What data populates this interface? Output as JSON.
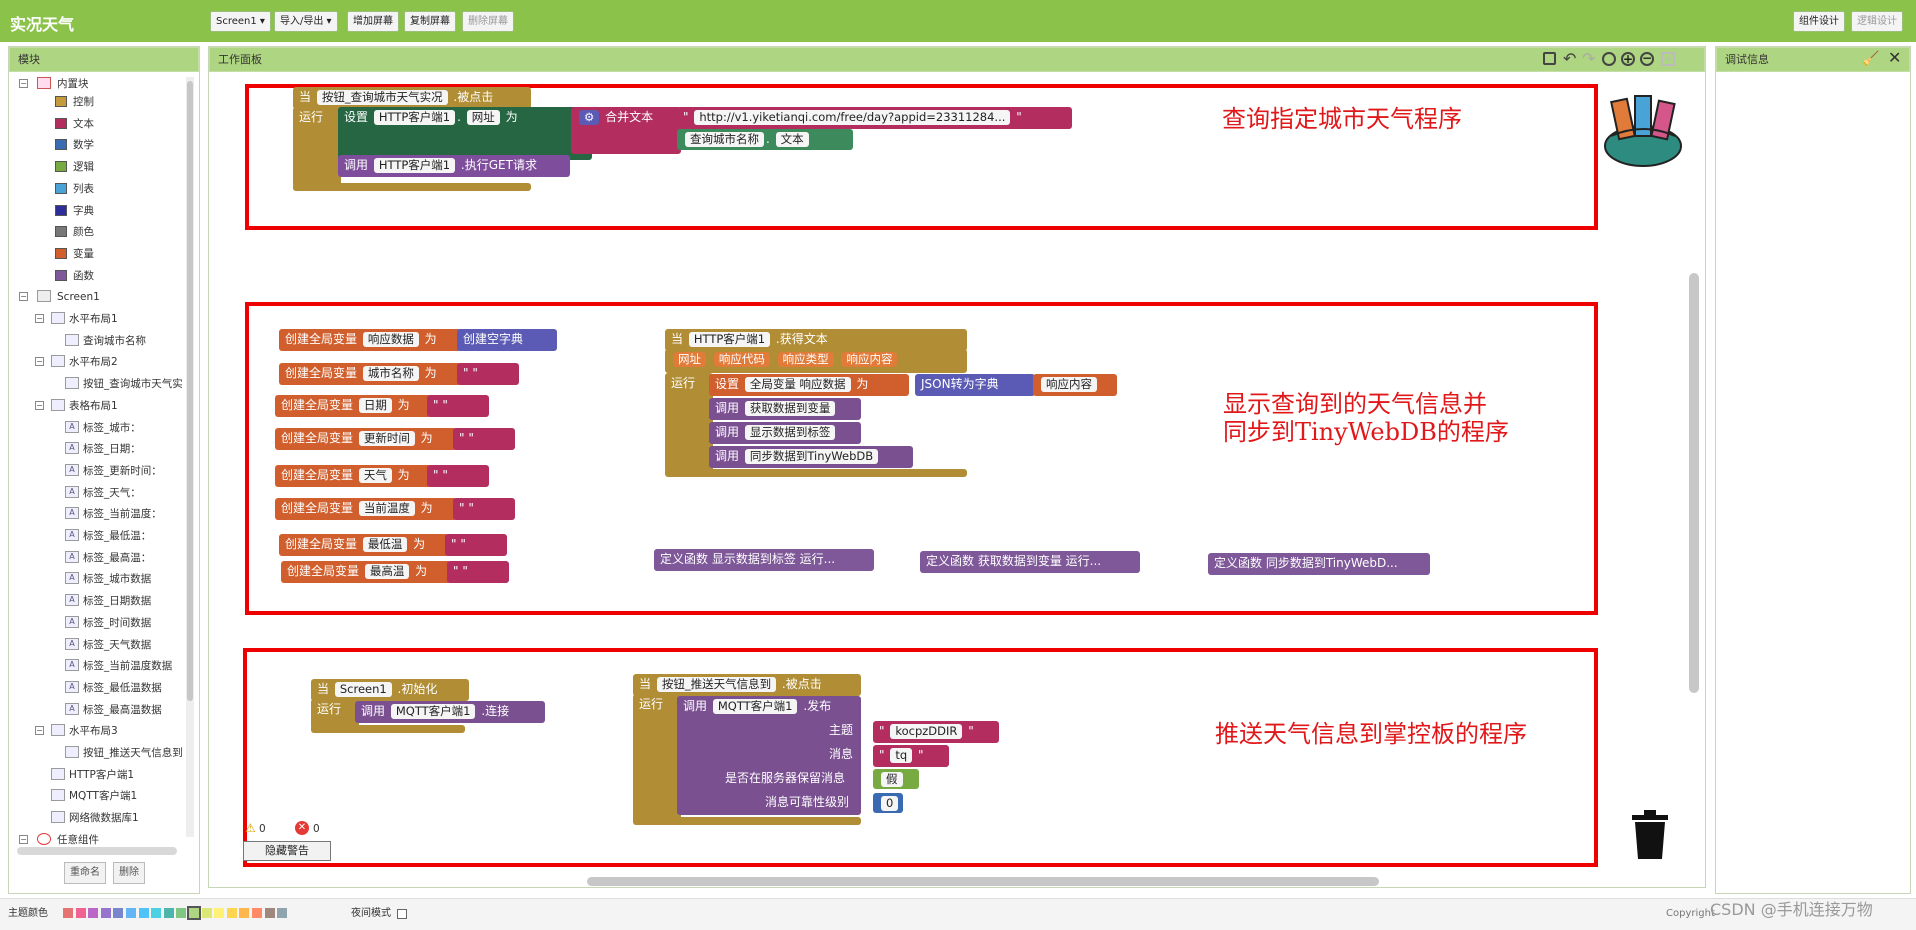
{
  "app": {
    "title": "实况天气"
  },
  "toolbar": {
    "screen_select": "Screen1 ▾",
    "import_export": "导入/导出 ▾",
    "add_screen": "增加屏幕",
    "copy_screen": "复制屏幕",
    "delete_screen": "删除屏幕",
    "designer": "组件设计",
    "blocks": "逻辑设计"
  },
  "left_panel": {
    "title": "模块",
    "builtins_label": "内置块",
    "builtins": [
      {
        "label": "控制",
        "color": "#c49b3a"
      },
      {
        "label": "文本",
        "color": "#b32d5e"
      },
      {
        "label": "数学",
        "color": "#3a6ab1"
      },
      {
        "label": "逻辑",
        "color": "#77ab41"
      },
      {
        "label": "列表",
        "color": "#4aa3d6"
      },
      {
        "label": "字典",
        "color": "#2d2d9c"
      },
      {
        "label": "颜色",
        "color": "#777777"
      },
      {
        "label": "变量",
        "color": "#d05f2d"
      },
      {
        "label": "函数",
        "color": "#7e5898"
      }
    ],
    "screen_label": "Screen1",
    "components": [
      {
        "label": "水平布局1",
        "level": 1
      },
      {
        "label": "查询城市名称",
        "level": 2
      },
      {
        "label": "水平布局2",
        "level": 1
      },
      {
        "label": "按钮_查询城市天气实",
        "level": 2
      },
      {
        "label": "表格布局1",
        "level": 1
      },
      {
        "label": "标签_城市：",
        "level": 2
      },
      {
        "label": "标签_日期：",
        "level": 2
      },
      {
        "label": "标签_更新时间：",
        "level": 2
      },
      {
        "label": "标签_天气：",
        "level": 2
      },
      {
        "label": "标签_当前温度：",
        "level": 2
      },
      {
        "label": "标签_最低温：",
        "level": 2
      },
      {
        "label": "标签_最高温：",
        "level": 2
      },
      {
        "label": "标签_城市数据",
        "level": 2
      },
      {
        "label": "标签_日期数据",
        "level": 2
      },
      {
        "label": "标签_时间数据",
        "level": 2
      },
      {
        "label": "标签_天气数据",
        "level": 2
      },
      {
        "label": "标签_当前温度数据",
        "level": 2
      },
      {
        "label": "标签_最低温数据",
        "level": 2
      },
      {
        "label": "标签_最高温数据",
        "level": 2
      },
      {
        "label": "水平布局3",
        "level": 1
      },
      {
        "label": "按钮_推送天气信息到",
        "level": 2
      },
      {
        "label": "HTTP客户端1",
        "level": 1
      },
      {
        "label": "MQTT客户端1",
        "level": 1
      },
      {
        "label": "网络微数据库1",
        "level": 1
      }
    ],
    "any_component": "任意组件",
    "rename_btn": "重命名",
    "delete_btn": "删除"
  },
  "workspace": {
    "title": "工作面板",
    "section1": {
      "note": "查询指定城市天气程序",
      "when": "当",
      "button": "按钮_查询城市天气实况",
      "event": ".被点击",
      "do": "运行",
      "set": "设置",
      "http": "HTTP客户端1",
      "dot": ".",
      "prop_url": "网址",
      "to": "为",
      "join": "合并文本",
      "quote": "\"",
      "url_text": "http://v1.yiketianqi.com/free/day?appid=23311284...",
      "city_comp": "查询城市名称",
      "prop_text": "文本",
      "call": "调用",
      "get_method": ".执行GET请求"
    },
    "section2": {
      "note1": "显示查询到的天气信息并",
      "note2": "同步到TinyWebDB的程序",
      "globals_prefix": "创建全局变量",
      "to": "为",
      "globals": [
        {
          "name": "响应数据",
          "init": "创建空字典"
        },
        {
          "name": "城市名称",
          "init": "\" \""
        },
        {
          "name": "日期",
          "init": "\" \""
        },
        {
          "name": "更新时间",
          "init": "\" \""
        },
        {
          "name": "天气",
          "init": "\" \""
        },
        {
          "name": "当前温度",
          "init": "\" \""
        },
        {
          "name": "最低温",
          "init": "\" \""
        },
        {
          "name": "最高温",
          "init": "\" \""
        }
      ],
      "when": "当",
      "http": "HTTP客户端1",
      "got_text": ".获得文本",
      "params": [
        "网址",
        "响应代码",
        "响应类型",
        "响应内容"
      ],
      "do": "运行",
      "set": "设置",
      "global_var": "全局变量 响应数据",
      "json_to_dict": "JSON转为字典",
      "resp_content": "响应内容",
      "call": "调用",
      "calls": [
        "获取数据到变量",
        "显示数据到标签",
        "同步数据到TinyWebDB"
      ],
      "procs": [
        "定义函数 显示数据到标签 运行...",
        "定义函数 获取数据到变量 运行...",
        "定义函数 同步数据到TinyWebD..."
      ]
    },
    "section3": {
      "note": "推送天气信息到掌控板的程序",
      "when": "当",
      "screen": "Screen1",
      "init": ".初始化",
      "do": "运行",
      "call": "调用",
      "mqtt": "MQTT客户端1",
      "connect": ".连接",
      "button": "按钮_推送天气信息到",
      "click": ".被点击",
      "publish": ".发布",
      "topic_label": "主题",
      "topic": "kocpzDDIR",
      "msg_label": "消息",
      "msg": "tq",
      "retain_label": "是否在服务器保留消息",
      "retain": "假",
      "qos_label": "消息可靠性级别",
      "qos": "0"
    },
    "warnings": "0",
    "errors": "0",
    "hide_warnings": "隐藏警告"
  },
  "right_panel": {
    "title": "调试信息"
  },
  "bottom": {
    "theme_label": "主题颜色",
    "theme_colors": [
      "#e57373",
      "#f06292",
      "#ba68c8",
      "#9575cd",
      "#7986cb",
      "#64b5f6",
      "#4fc3f7",
      "#4dd0e1",
      "#4db6ac",
      "#81c784",
      "#aed581",
      "#dce775",
      "#fff176",
      "#ffd54f",
      "#ffb74d",
      "#ff8a65",
      "#a1887f",
      "#90a4ae"
    ],
    "night_mode": "夜间模式",
    "copyright": "Copyright",
    "watermark": "CSDN @手机连接万物"
  }
}
